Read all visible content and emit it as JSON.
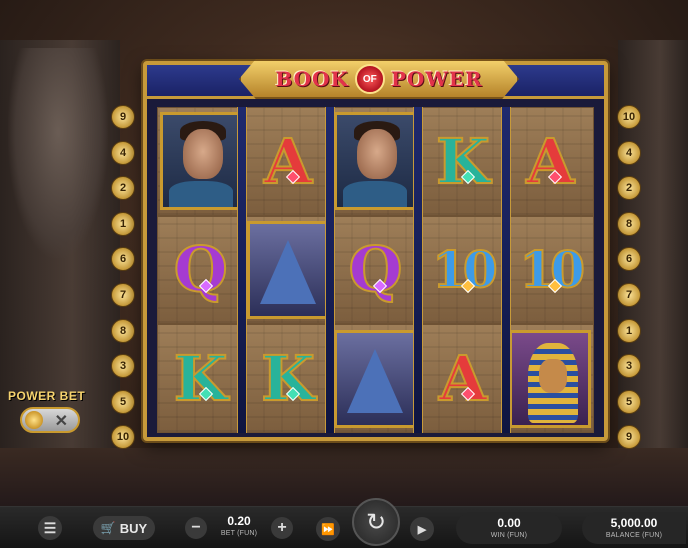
{
  "game": {
    "logo_left": "BOOK",
    "logo_center": "OF",
    "logo_right": "POWER"
  },
  "paylines": {
    "left": [
      "9",
      "4",
      "2",
      "1",
      "6",
      "7",
      "8",
      "3",
      "5",
      "10"
    ],
    "right": [
      "10",
      "4",
      "2",
      "8",
      "6",
      "7",
      "1",
      "3",
      "5",
      "9"
    ]
  },
  "reels": [
    [
      "explorer",
      "A",
      "explorer",
      "K",
      "A"
    ],
    [
      "Q",
      "pyramid",
      "Q",
      "10",
      "10"
    ],
    [
      "K",
      "K",
      "pyramid",
      "A",
      "pharaoh"
    ]
  ],
  "power_bet": {
    "label": "POWER BET",
    "toggle_state": "off",
    "off_glyph": "✕"
  },
  "controls": {
    "menu_glyph": "☰",
    "buy_label": "BUY",
    "buy_icon": "🛒",
    "minus_glyph": "−",
    "plus_glyph": "+",
    "turbo_glyph": "⏩",
    "spin_glyph": "↻",
    "auto_glyph": "▶",
    "bet_value": "0.20",
    "bet_caption": "BET (FUN)",
    "win_value": "0.00",
    "win_caption": "WIN (FUN)",
    "balance_value": "5,000.00",
    "balance_caption": "BALANCE (FUN)"
  },
  "colors": {
    "gold": "#c79a3a",
    "frame_blue": "#1a2266",
    "A": "#e53b3b",
    "K": "#28b39a",
    "Q": "#a53bd1",
    "10": "#3d9be8"
  }
}
